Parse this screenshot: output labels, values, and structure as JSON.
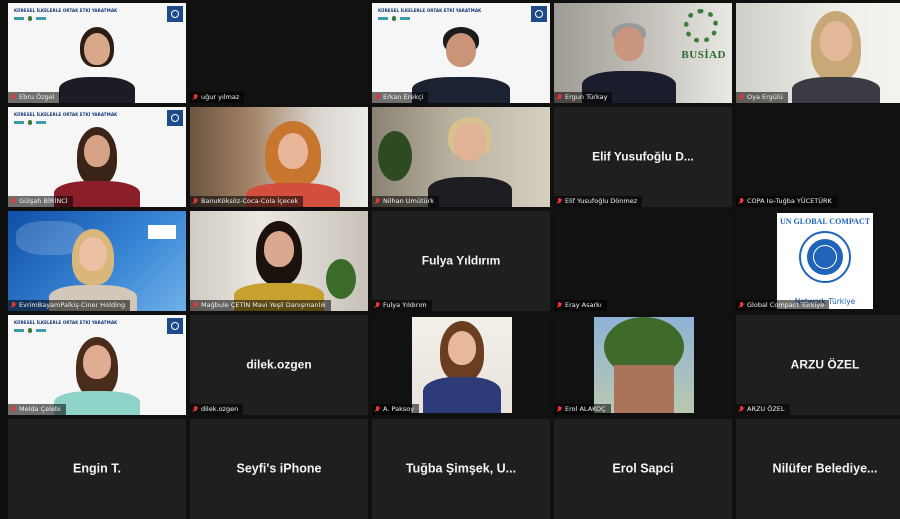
{
  "slide": {
    "title": "KÜRESEL İLKELERLE ORTAK ETKİ YARATMAK"
  },
  "tiles": [
    {
      "name": "Ebru Özgel",
      "kind": "slide"
    },
    {
      "name": "uğur yılmaz",
      "kind": "black"
    },
    {
      "name": "Erkan Erekçi",
      "kind": "slide"
    },
    {
      "name": "Ergun Türkay",
      "kind": "busiad",
      "logo_text": "BUSİAD"
    },
    {
      "name": "Oya Ergülü",
      "kind": "webcam",
      "active": true
    },
    {
      "name": "Gülşah BİRİNCİ",
      "kind": "slide"
    },
    {
      "name": "BanuKöksöz-Coca-Cola İçecek",
      "kind": "webcam"
    },
    {
      "name": "Nilhan Umütürk",
      "kind": "webcam"
    },
    {
      "name": "Elif Yusufoğlu Dönmez",
      "kind": "text",
      "display": "Elif Yusufoğlu D..."
    },
    {
      "name": "COPA Isı-Tuğba YÜCETÜRK",
      "kind": "black"
    },
    {
      "name": "EvrimBayamPalkiş-Ciner Holding",
      "kind": "map"
    },
    {
      "name": "Mağbule ÇETİN Mavi Yeşil Danışmanlık",
      "kind": "webcam"
    },
    {
      "name": "Fulya Yıldırım",
      "kind": "text",
      "display": "Fulya Yıldırım"
    },
    {
      "name": "Eray Asarkı",
      "kind": "black"
    },
    {
      "name": "Global Compact Türkiye",
      "kind": "ungc",
      "logo_title": "UN GLOBAL COMPACT",
      "logo_sub": "Network Türkiye"
    },
    {
      "name": "Melda Çelebi",
      "kind": "slide"
    },
    {
      "name": "dilek.ozgen",
      "kind": "text",
      "display": "dilek.ozgen"
    },
    {
      "name": "A. Paksoy",
      "kind": "photo"
    },
    {
      "name": "Erol ALAKOÇ",
      "kind": "tree"
    },
    {
      "name": "ARZU ÖZEL",
      "kind": "text",
      "display": "ARZU ÖZEL"
    }
  ],
  "bottom_row": [
    "Engin T.",
    "Seyfi's iPhone",
    "Tuğba Şimşek, U...",
    "Erol Sapci",
    "Nilüfer Belediye..."
  ]
}
